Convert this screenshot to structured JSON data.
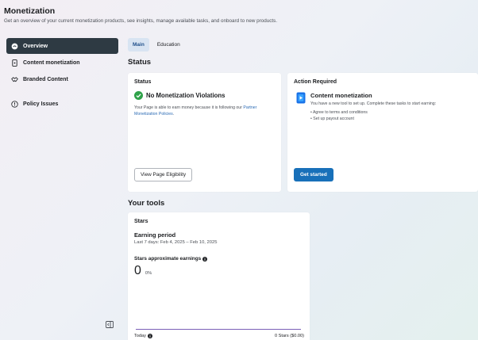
{
  "header": {
    "title": "Monetization",
    "subtitle": "Get an overview of your current monetization products, see insights, manage available tasks, and onboard to new products."
  },
  "sidebar": {
    "items": [
      {
        "label": "Overview",
        "icon": "overview-icon"
      },
      {
        "label": "Content monetization",
        "icon": "phone-icon"
      },
      {
        "label": "Branded Content",
        "icon": "handshake-icon"
      },
      {
        "label": "Policy Issues",
        "icon": "alert-circle-icon"
      }
    ]
  },
  "tabs": [
    {
      "label": "Main"
    },
    {
      "label": "Education"
    }
  ],
  "status_section": {
    "heading": "Status",
    "card_title": "Status",
    "status_text": "No Monetization Violations",
    "desc_before_link": "Your Page is able to earn money because it is following our ",
    "link_text": "Partner Monetization Policies",
    "desc_after_link": ".",
    "button": "View Page Eligibility"
  },
  "action_section": {
    "card_title": "Action Required",
    "item_title": "Content monetization",
    "item_desc": "You have a new tool to set up. Complete these tasks to start earning:",
    "tasks": [
      "• Agree to terms and conditions",
      "• Set up payout account"
    ],
    "button": "Get started"
  },
  "tools_section": {
    "heading": "Your tools",
    "card_title": "Stars",
    "period_title": "Earning period",
    "period_range": "Last 7 days: Feb 4, 2025 – Feb 10, 2025",
    "earnings_label": "Stars approximate earnings",
    "earnings_value": "0",
    "earnings_pct": "0%",
    "foot_left": "Today",
    "foot_right": "0 Stars ($0.00)"
  },
  "colors": {
    "accent": "#1870b9",
    "active_nav": "#2e3a43",
    "success": "#2fa24a",
    "chart_line": "#7b5fb7"
  }
}
